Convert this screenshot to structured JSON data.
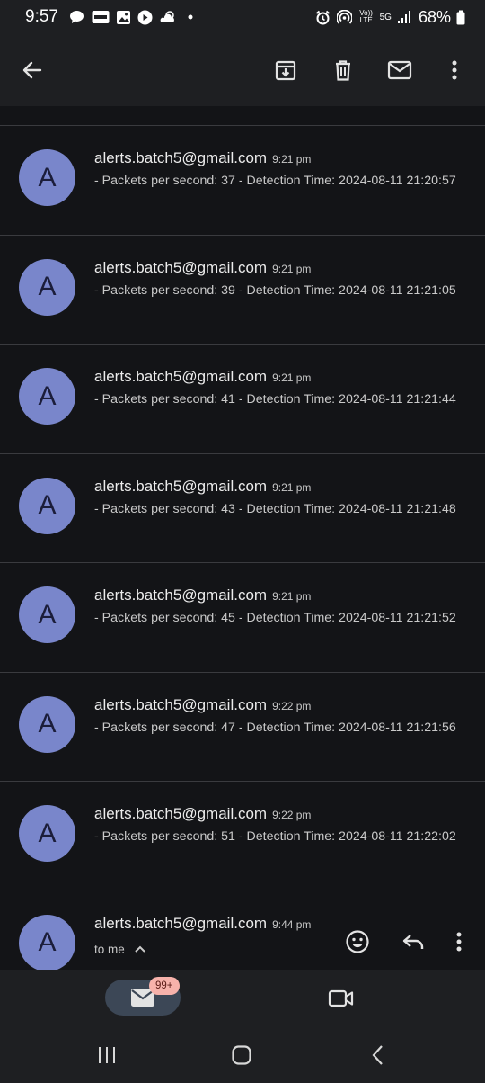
{
  "status_bar": {
    "time": "9:57",
    "battery": "68%",
    "network": "5G",
    "left_icons": [
      "chat-icon",
      "news-icon",
      "gallery-icon",
      "youtube-icon",
      "weather-icon",
      "dot-icon"
    ],
    "right_icons": [
      "alarm-icon",
      "hotspot-icon",
      "volte-icon",
      "signal-icon",
      "battery-icon"
    ],
    "volte_label": "Vo)) LTE"
  },
  "toolbar": {
    "icons": [
      "back-arrow-icon",
      "archive-icon",
      "delete-icon",
      "mark-unread-icon",
      "more-vert-icon"
    ]
  },
  "emails": [
    {
      "avatar": "A",
      "sender": "alerts.batch5@gmail.com",
      "time": "9:21 pm",
      "snippet": "- Packets per second: 37 - Detection Time: 2024-08-11 21:20:57"
    },
    {
      "avatar": "A",
      "sender": "alerts.batch5@gmail.com",
      "time": "9:21 pm",
      "snippet": "- Packets per second: 39 - Detection Time: 2024-08-11 21:21:05"
    },
    {
      "avatar": "A",
      "sender": "alerts.batch5@gmail.com",
      "time": "9:21 pm",
      "snippet": "- Packets per second: 41 - Detection Time: 2024-08-11 21:21:44"
    },
    {
      "avatar": "A",
      "sender": "alerts.batch5@gmail.com",
      "time": "9:21 pm",
      "snippet": "- Packets per second: 43 - Detection Time: 2024-08-11 21:21:48"
    },
    {
      "avatar": "A",
      "sender": "alerts.batch5@gmail.com",
      "time": "9:21 pm",
      "snippet": "- Packets per second: 45 - Detection Time: 2024-08-11 21:21:52"
    },
    {
      "avatar": "A",
      "sender": "alerts.batch5@gmail.com",
      "time": "9:22 pm",
      "snippet": "- Packets per second: 47 - Detection Time: 2024-08-11 21:21:56"
    },
    {
      "avatar": "A",
      "sender": "alerts.batch5@gmail.com",
      "time": "9:22 pm",
      "snippet": "- Packets per second: 51 - Detection Time: 2024-08-11 21:22:02"
    }
  ],
  "expanded_email": {
    "avatar": "A",
    "sender": "alerts.batch5@gmail.com",
    "time": "9:44 pm",
    "recipient": "to me"
  },
  "bottom_nav": {
    "mail_badge": "99+"
  },
  "colors": {
    "background": "#131417",
    "bar": "#1e1f22",
    "avatar": "#7986cb",
    "divider": "#3a3b3f",
    "badge": "#f7b2ab",
    "nav_active": "#3c4756"
  }
}
